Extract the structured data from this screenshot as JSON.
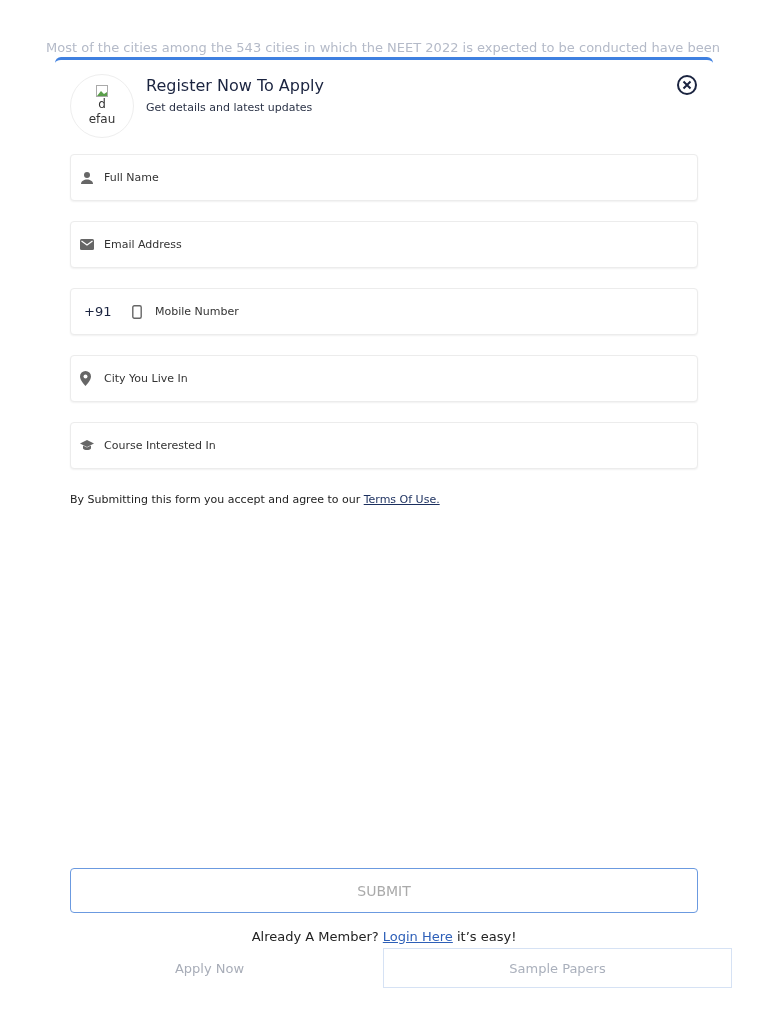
{
  "background": {
    "text": "Most of the cities among the 543 cities in which the NEET 2022 is expected to be conducted have been",
    "buttons": [
      {
        "label": "Apply Now",
        "kind": "plain"
      },
      {
        "label": "Sample Papers",
        "kind": "outlined"
      }
    ]
  },
  "modal": {
    "logo_alt": "d efau",
    "title": "Register Now To Apply",
    "subtitle": "Get details and latest updates",
    "fields": [
      {
        "kind": "person",
        "placeholder": "Full Name"
      },
      {
        "kind": "mail",
        "placeholder": "Email Address"
      },
      {
        "kind": "phone",
        "prefix": "+91",
        "placeholder": "Mobile Number"
      },
      {
        "kind": "pin",
        "placeholder": "City You Live In"
      },
      {
        "kind": "cap",
        "placeholder": "Course Interested In"
      }
    ],
    "terms_text": "By Submitting this form you accept and agree to our",
    "terms_link": "Terms Of Use.",
    "submit": "SUBMIT",
    "login_text": "Already A Member?",
    "login_link": "Login Here",
    "login_suffix": "it’s easy!"
  }
}
